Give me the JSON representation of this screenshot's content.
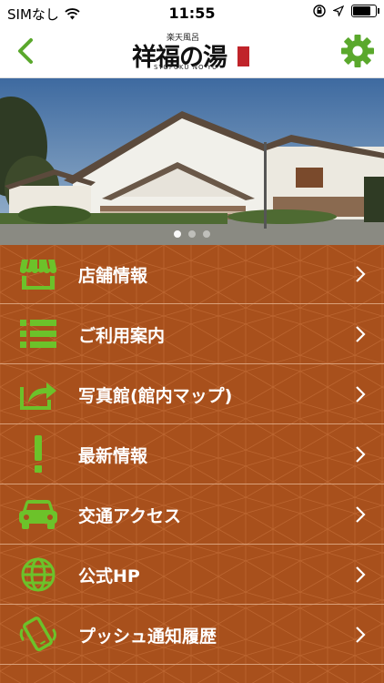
{
  "status_bar": {
    "carrier": "SIMなし",
    "time": "11:55",
    "battery_level": 0.85
  },
  "nav": {
    "logo_small": "楽天風呂",
    "logo_main": "祥福の湯",
    "logo_sub": "SYOFUKU NO YU",
    "accent": "#5aa82c"
  },
  "carousel": {
    "page_count": 3,
    "active_index": 0
  },
  "menu": {
    "items": [
      {
        "label": "店舗情報",
        "icon": "store-icon"
      },
      {
        "label": "ご利用案内",
        "icon": "list-icon"
      },
      {
        "label": "写真館(館内マップ)",
        "icon": "share-icon"
      },
      {
        "label": "最新情報",
        "icon": "exclamation-icon"
      },
      {
        "label": "交通アクセス",
        "icon": "car-icon"
      },
      {
        "label": "公式HP",
        "icon": "globe-icon"
      },
      {
        "label": "プッシュ通知履歴",
        "icon": "vibrating-phone-icon"
      }
    ],
    "background": "#a8501c",
    "icon_color": "#6cc22a"
  }
}
